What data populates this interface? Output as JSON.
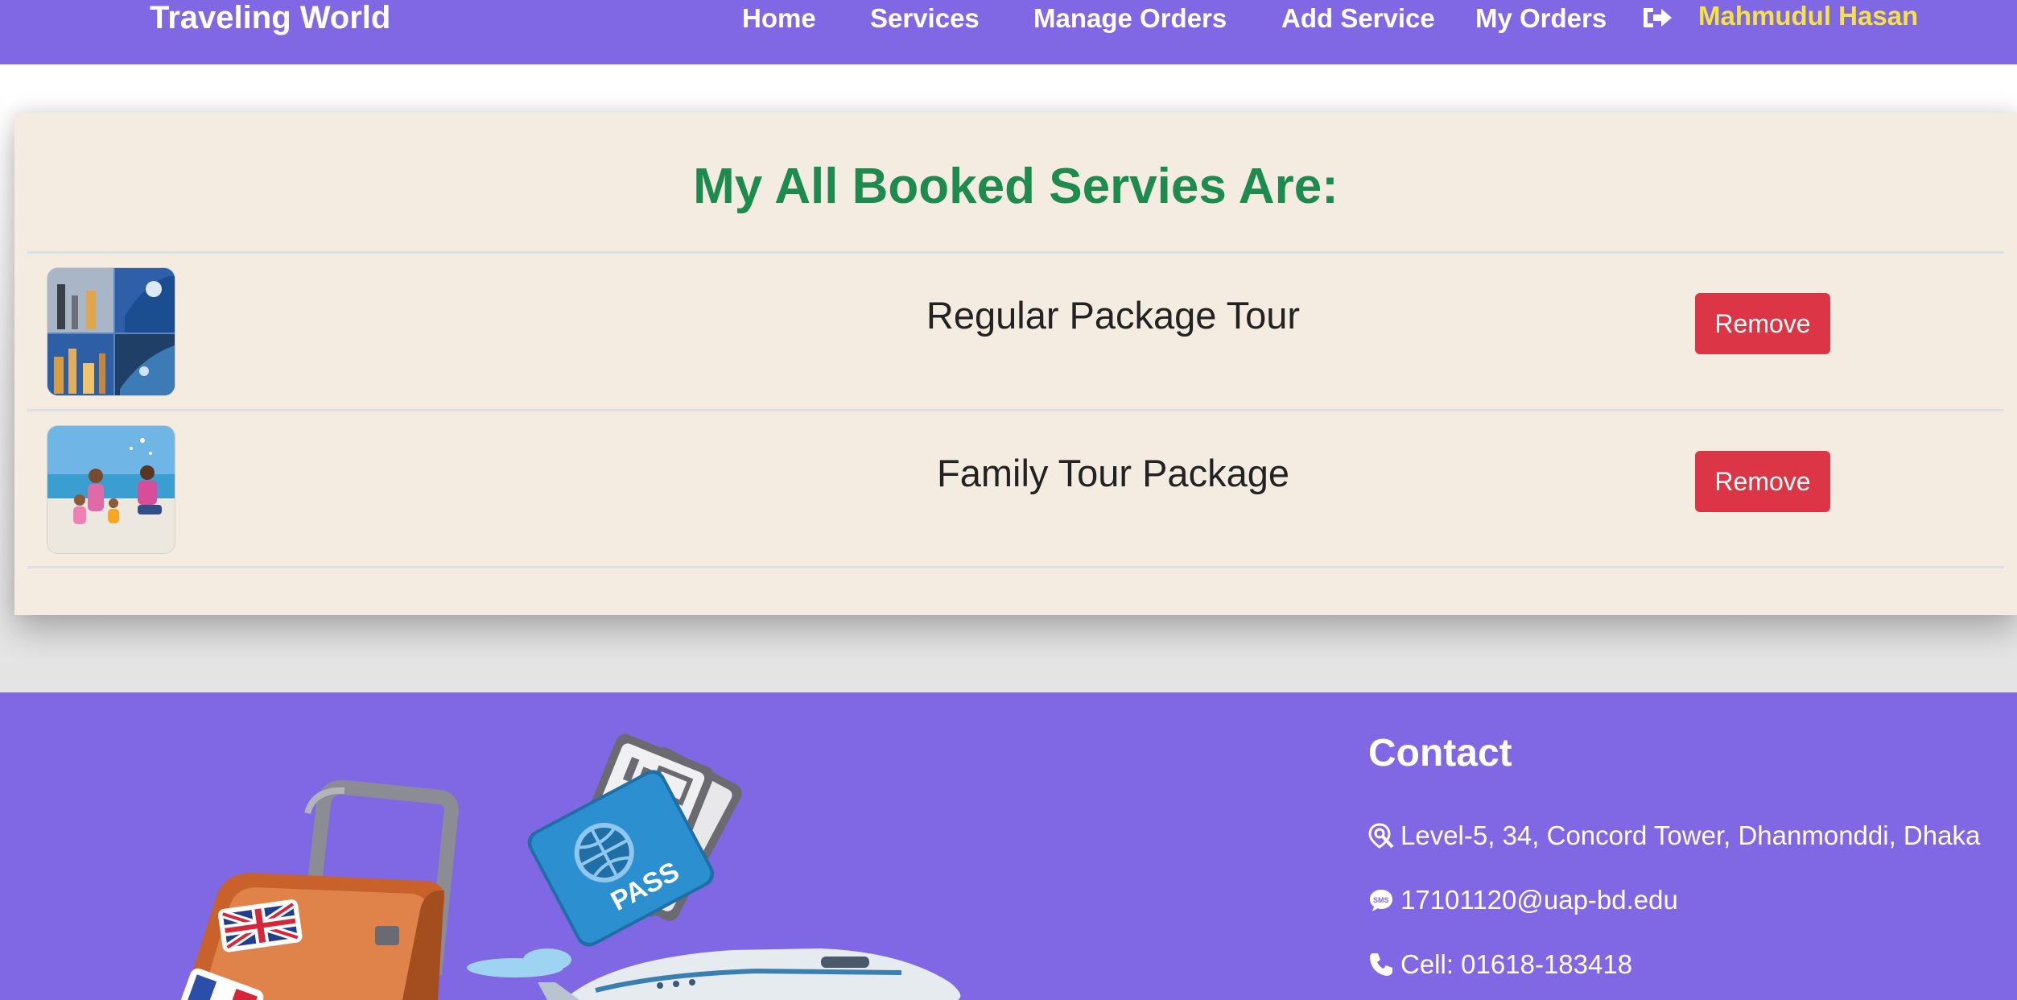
{
  "navbar": {
    "brand": "Traveling World",
    "links": [
      "Home",
      "Services",
      "Manage Orders",
      "Add Service",
      "My Orders"
    ],
    "logout_icon": "sign-out-icon",
    "user_name": "Mahmudul Hasan",
    "colors": {
      "background": "#8068e4",
      "user_name": "#f5e342"
    }
  },
  "orders": {
    "title": "My All Booked Servies Are:",
    "title_color": "#1d8a4e",
    "items": [
      {
        "name": "Regular Package Tour",
        "button": "Remove",
        "thumbnail": "city-collage-image"
      },
      {
        "name": "Family Tour Package",
        "button": "Remove",
        "thumbnail": "family-beach-image"
      }
    ],
    "button_color": "#dc3545"
  },
  "footer": {
    "illustration": "travel-luggage-passport-airplane-image",
    "contact_title": "Contact",
    "address": "Level-5, 34, Concord Tower, Dhanmonddi, Dhaka",
    "email": "17101120@uap-bd.edu",
    "phone": "Cell: 01618-183418",
    "icons": [
      "location-search-icon",
      "sms-icon",
      "phone-icon"
    ]
  }
}
